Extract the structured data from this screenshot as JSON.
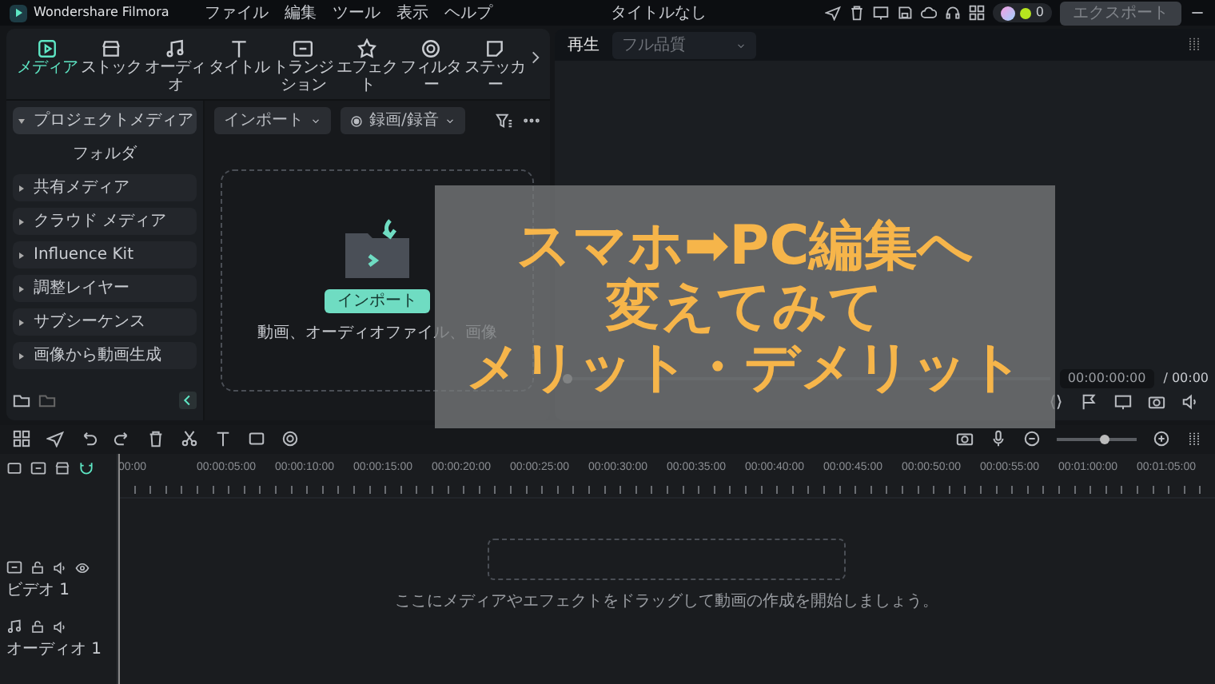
{
  "app": {
    "name": "Wondershare Filmora",
    "menus": [
      "ファイル",
      "編集",
      "ツール",
      "表示",
      "ヘルプ"
    ],
    "title": "タイトルなし",
    "credits": "0",
    "export_button": "エクスポート"
  },
  "media_tabs": [
    {
      "label": "メディア",
      "selected": true
    },
    {
      "label": "ストック",
      "selected": false
    },
    {
      "label": "オーディオ",
      "selected": false
    },
    {
      "label": "タイトル",
      "selected": false
    },
    {
      "label": "トランジション",
      "selected": false
    },
    {
      "label": "エフェクト",
      "selected": false
    },
    {
      "label": "フィルター",
      "selected": false
    },
    {
      "label": "ステッカー",
      "selected": false
    }
  ],
  "media_toolbar": {
    "import": "インポート",
    "record": "録画/録音"
  },
  "sidebar": {
    "project_media": {
      "label": "プロジェクトメディア",
      "expanded": true,
      "selected": true
    },
    "folder": "フォルダ",
    "items": [
      {
        "label": "共有メディア",
        "expanded": false,
        "selected": false
      },
      {
        "label": "クラウド メディア",
        "expanded": false,
        "selected": false
      },
      {
        "label": "Influence Kit",
        "expanded": false,
        "selected": false
      },
      {
        "label": "調整レイヤー",
        "expanded": false,
        "selected": false
      },
      {
        "label": "サブシーケンス",
        "expanded": false,
        "selected": false
      },
      {
        "label": "画像から動画生成",
        "expanded": false,
        "selected": false
      }
    ]
  },
  "drop_zone": {
    "button": "インポート",
    "hint": "動画、オーディオファイル、画像"
  },
  "player": {
    "label": "再生",
    "quality": "フル品質",
    "progress": {
      "level": 0
    },
    "timecode": "00:00:00:00",
    "duration": "/ 00:00"
  },
  "timeline": {
    "ruler": [
      "00:00",
      "00:00:05:00",
      "00:00:10:00",
      "00:00:15:00",
      "00:00:20:00",
      "00:00:25:00",
      "00:00:30:00",
      "00:00:35:00",
      "00:00:40:00",
      "00:00:45:00",
      "00:00:50:00",
      "00:00:55:00",
      "00:01:00:00",
      "00:01:05:00"
    ],
    "tracks": [
      {
        "kind": "video",
        "name": "ビデオ 1"
      },
      {
        "kind": "audio",
        "name": "オーディオ 1"
      }
    ],
    "hint": "ここにメディアやエフェクトをドラッグして動画の作成を開始しましょう。",
    "zoom_slider": {
      "level": 0.6
    }
  },
  "overlay": {
    "lines": [
      "スマホ➡PC編集へ",
      "変えてみて",
      "メリット・デメリット"
    ]
  }
}
